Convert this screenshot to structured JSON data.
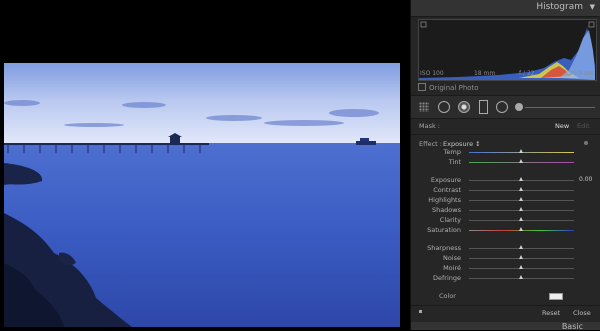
{
  "panel": {
    "histogram_title": "Histogram",
    "histogram_info": {
      "iso": "ISO 100",
      "focal": "18 mm",
      "aperture": "f / 22",
      "shutter": "20.0 sec"
    },
    "original_photo_label": "Original Photo"
  },
  "mask": {
    "label": "Mask :",
    "new": "New",
    "edit": "Edit"
  },
  "effect": {
    "label": "Effect :",
    "value": "Exposure ↕"
  },
  "sliders": [
    {
      "label": "Temp",
      "value": "",
      "pos": 0.5,
      "track": "temp"
    },
    {
      "label": "Tint",
      "value": "",
      "pos": 0.5,
      "track": "tint"
    },
    {
      "label": "Exposure",
      "value": "0.00",
      "pos": 0.5,
      "track": "plain"
    },
    {
      "label": "Contrast",
      "value": "",
      "pos": 0.5,
      "track": "plain"
    },
    {
      "label": "Highlights",
      "value": "",
      "pos": 0.5,
      "track": "plain"
    },
    {
      "label": "Shadows",
      "value": "",
      "pos": 0.5,
      "track": "plain"
    },
    {
      "label": "Clarity",
      "value": "",
      "pos": 0.5,
      "track": "plain"
    },
    {
      "label": "Saturation",
      "value": "",
      "pos": 0.5,
      "track": "sat"
    },
    {
      "label": "Sharpness",
      "value": "",
      "pos": 0.5,
      "track": "plain"
    },
    {
      "label": "Noise",
      "value": "",
      "pos": 0.5,
      "track": "plain"
    },
    {
      "label": "Moiré",
      "value": "",
      "pos": 0.5,
      "track": "plain"
    },
    {
      "label": "Defringe",
      "value": "",
      "pos": 0.5,
      "track": "plain"
    }
  ],
  "color_label": "Color",
  "footer": {
    "reset": "Reset",
    "close": "Close"
  },
  "basic_title": "Basic",
  "colors": {
    "accent": "#d0d0d0",
    "panel_bg": "#262626"
  }
}
